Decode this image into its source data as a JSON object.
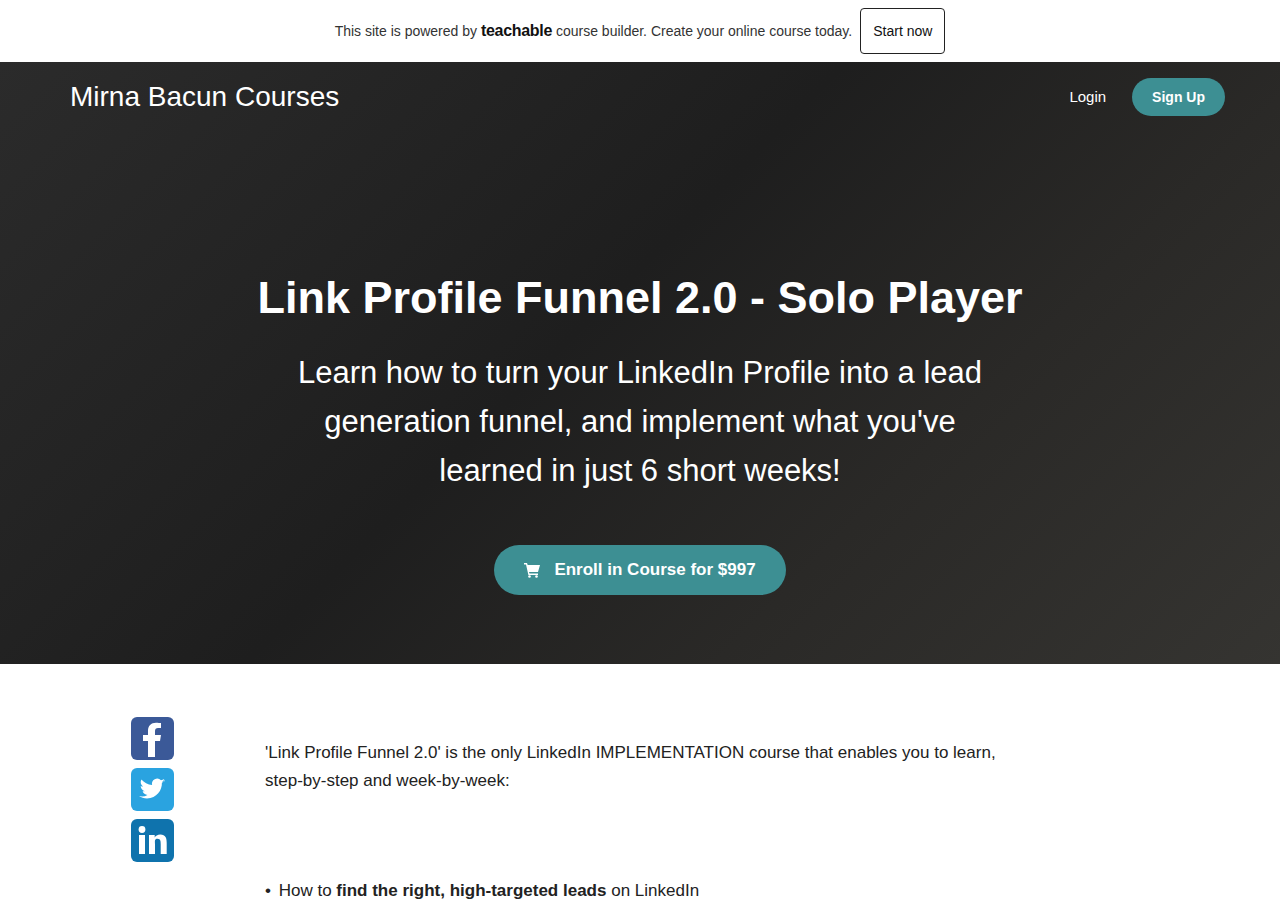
{
  "banner": {
    "prefix": "This site is powered by",
    "brand": "teachable",
    "suffix": "course builder. Create your online course today.",
    "button": "Start now"
  },
  "nav": {
    "brand": "Mirna Bacun Courses",
    "login": "Login",
    "signup": "Sign Up"
  },
  "hero": {
    "title": "Link Profile Funnel 2.0 - Solo Player",
    "subtitle": "Learn how to turn your LinkedIn Profile into a lead generation funnel, and implement what you've learned in just 6 short weeks!",
    "cta": "Enroll in Course for $997"
  },
  "share": [
    {
      "kind": "facebook"
    },
    {
      "kind": "twitter"
    },
    {
      "kind": "linkedin"
    }
  ],
  "content": {
    "intro": "'Link Profile Funnel 2.0' is the only LinkedIn IMPLEMENTATION course that enables you to learn, step-by-step and week-by-week:",
    "bullets": [
      {
        "bullet": "•",
        "parts": [
          {
            "text": "How to ",
            "bold": false
          },
          {
            "text": "find the right, high-targeted leads",
            "bold": true
          },
          {
            "text": " on LinkedIn",
            "bold": false
          }
        ]
      }
    ]
  }
}
